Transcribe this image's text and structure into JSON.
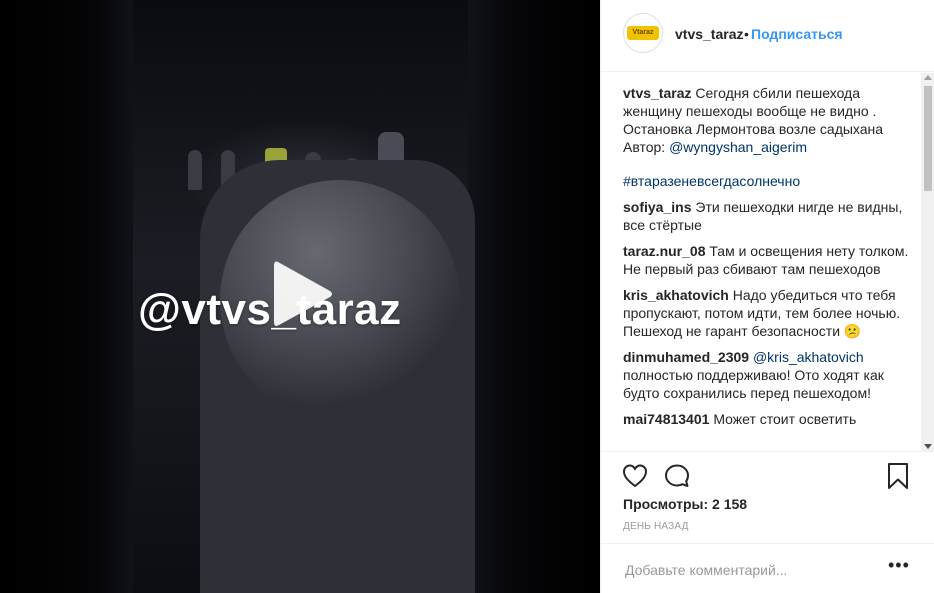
{
  "video": {
    "watermark": "@vtvs_taraz",
    "play_icon": "play-icon"
  },
  "header": {
    "username": "vtvs_taraz",
    "separator": "•",
    "follow_label": "Подписаться",
    "avatar_text": "Vtaraz"
  },
  "caption": {
    "username": "vtvs_taraz",
    "text": "Сегодня сбили пешехода женщину пешеходы вообще не видно . Остановка Лермонтова возле садыхана Автор:",
    "mention": "@wyngyshan_aigerim",
    "hashtag": "#втаразеневсегдасолнечно"
  },
  "comments": [
    {
      "username": "sofiya_ins",
      "text": "Эти пешеходки нигде не видны, все стёртые",
      "mention": ""
    },
    {
      "username": "taraz.nur_08",
      "text": "Там и освещения нету толком. Не первый раз сбивают там пешеходов",
      "mention": ""
    },
    {
      "username": "kris_akhatovich",
      "text": "Надо убедиться что тебя пропускают, потом идти, тем более ночью. Пешеход не гарант безопасности 😕",
      "mention": ""
    },
    {
      "username": "dinmuhamed_2309",
      "text": "полностью поддерживаю! Ото ходят как будто сохранились перед пешеходом!",
      "mention": "@kris_akhatovich"
    },
    {
      "username": "mai74813401",
      "text": "Может стоит осветить",
      "mention": ""
    }
  ],
  "actions": {
    "like_icon": "heart-icon",
    "comment_icon": "comment-icon",
    "save_icon": "bookmark-icon",
    "views": "Просмотры: 2 158",
    "date": "ДЕНЬ НАЗАД"
  },
  "add_comment": {
    "placeholder": "Добавьте комментарий...",
    "more_icon": "more-options-icon",
    "more_glyph": "•••"
  },
  "colors": {
    "accent": "#3897f0",
    "mention": "#003569",
    "text": "#262626",
    "muted": "#999999"
  }
}
